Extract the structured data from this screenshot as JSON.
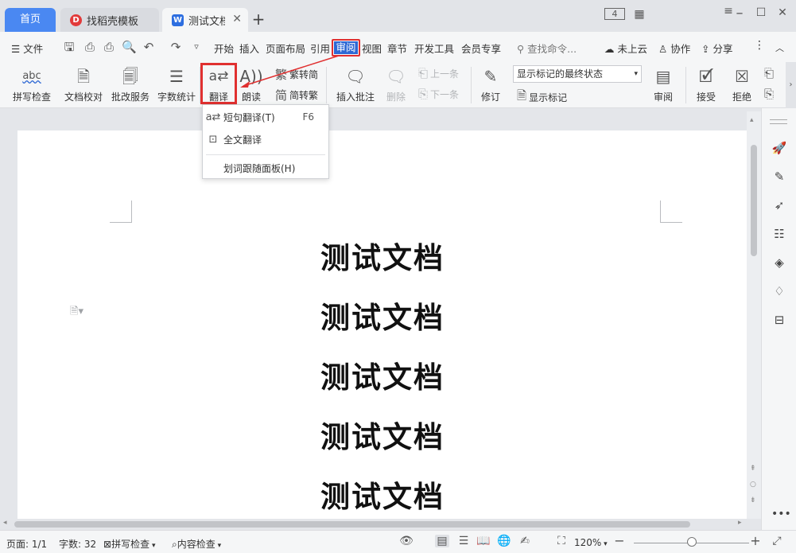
{
  "titlebar": {
    "home_tab": "首页",
    "template_tab": "找稻壳模板",
    "doc_tab": "测试文档",
    "doc_tab_badge": "W",
    "template_badge": "D",
    "window_count": "4"
  },
  "menu": {
    "file": "文件",
    "items": [
      "开始",
      "插入",
      "页面布局",
      "引用",
      "审阅",
      "视图",
      "章节",
      "开发工具",
      "会员专享"
    ],
    "active_index": 4,
    "search_placeholder": "查找命令...",
    "cloud": "未上云",
    "collab": "协作",
    "share": "分享"
  },
  "ribbon": {
    "spell_check": "拼写检查",
    "proofread": "文档校对",
    "correction": "批改服务",
    "word_count": "字数统计",
    "translate": "翻译",
    "read_aloud": "朗读",
    "to_simplified": "繁转简",
    "to_traditional": "简转繁",
    "insert_comment": "插入批注",
    "delete": "删除",
    "prev": "上一条",
    "next": "下一条",
    "revise": "修订",
    "markup_state": "显示标记的最终状态",
    "show_markup": "显示标记",
    "review": "审阅",
    "accept": "接受",
    "reject": "拒绝"
  },
  "translate_menu": {
    "short": "短句翻译(T)",
    "short_key": "F6",
    "full": "全文翻译",
    "panel": "划词跟随面板(H)"
  },
  "document": {
    "headings": [
      "测试文档",
      "测试文档",
      "测试文档",
      "测试文档",
      "测试文档"
    ]
  },
  "status": {
    "page": "页面: 1/1",
    "words": "字数: 32",
    "spell": "拼写检查",
    "content_check": "内容检查",
    "zoom": "120%",
    "zoom_fraction": 0.5
  },
  "colors": {
    "accent": "#2e68d4",
    "highlight": "#e03030",
    "home_tab": "#4a88f2"
  }
}
